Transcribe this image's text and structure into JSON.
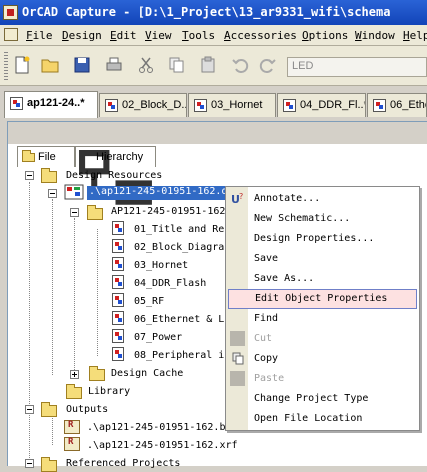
{
  "window": {
    "title": "OrCAD Capture - [D:\\1_Project\\13_ar9331_wifi\\schema"
  },
  "menu": [
    "File",
    "Design",
    "Edit",
    "View",
    "Tools",
    "Accessories",
    "Options",
    "Window",
    "Help"
  ],
  "toolbar": {
    "part_combo_value": "LED"
  },
  "doc_tabs": [
    "ap121-24..*",
    "02_Block_D...",
    "03_Hornet",
    "04_DDR_Fl..*",
    "06_Ethe"
  ],
  "panel_tabs": {
    "file": "File",
    "hierarchy": "Hierarchy"
  },
  "tree": {
    "design_resources": "Design Resources",
    "design_file": ".\\ap121-245-01951-162.dsn",
    "schematic_folder": "AP121-245-01951-162",
    "pages": [
      "01_Title and Re",
      "02_Block_Diagra",
      "03_Hornet",
      "04_DDR_Flash",
      "05_RF",
      "06_Ethernet & L",
      "07_Power",
      "08_Peripheral i"
    ],
    "design_cache": "Design Cache",
    "library": "Library",
    "outputs": "Outputs",
    "output_files": [
      ".\\ap121-245-01951-162.b",
      ".\\ap121-245-01951-162.xrf"
    ],
    "referenced_projects": "Referenced Projects"
  },
  "context_menu": {
    "items": [
      {
        "label": "Annotate...",
        "enabled": true
      },
      {
        "label": "New Schematic...",
        "enabled": true
      },
      {
        "label": "Design Properties...",
        "enabled": true
      },
      {
        "label": "Save",
        "enabled": true
      },
      {
        "label": "Save As...",
        "enabled": true
      },
      {
        "label": "Edit Object Properties",
        "enabled": true,
        "highlighted": true
      },
      {
        "label": "Find",
        "enabled": true
      },
      {
        "label": "Cut",
        "enabled": false
      },
      {
        "label": "Copy",
        "enabled": true
      },
      {
        "label": "Paste",
        "enabled": false
      },
      {
        "label": "Change Project Type",
        "enabled": true
      },
      {
        "label": "Open File Location",
        "enabled": true
      }
    ]
  }
}
